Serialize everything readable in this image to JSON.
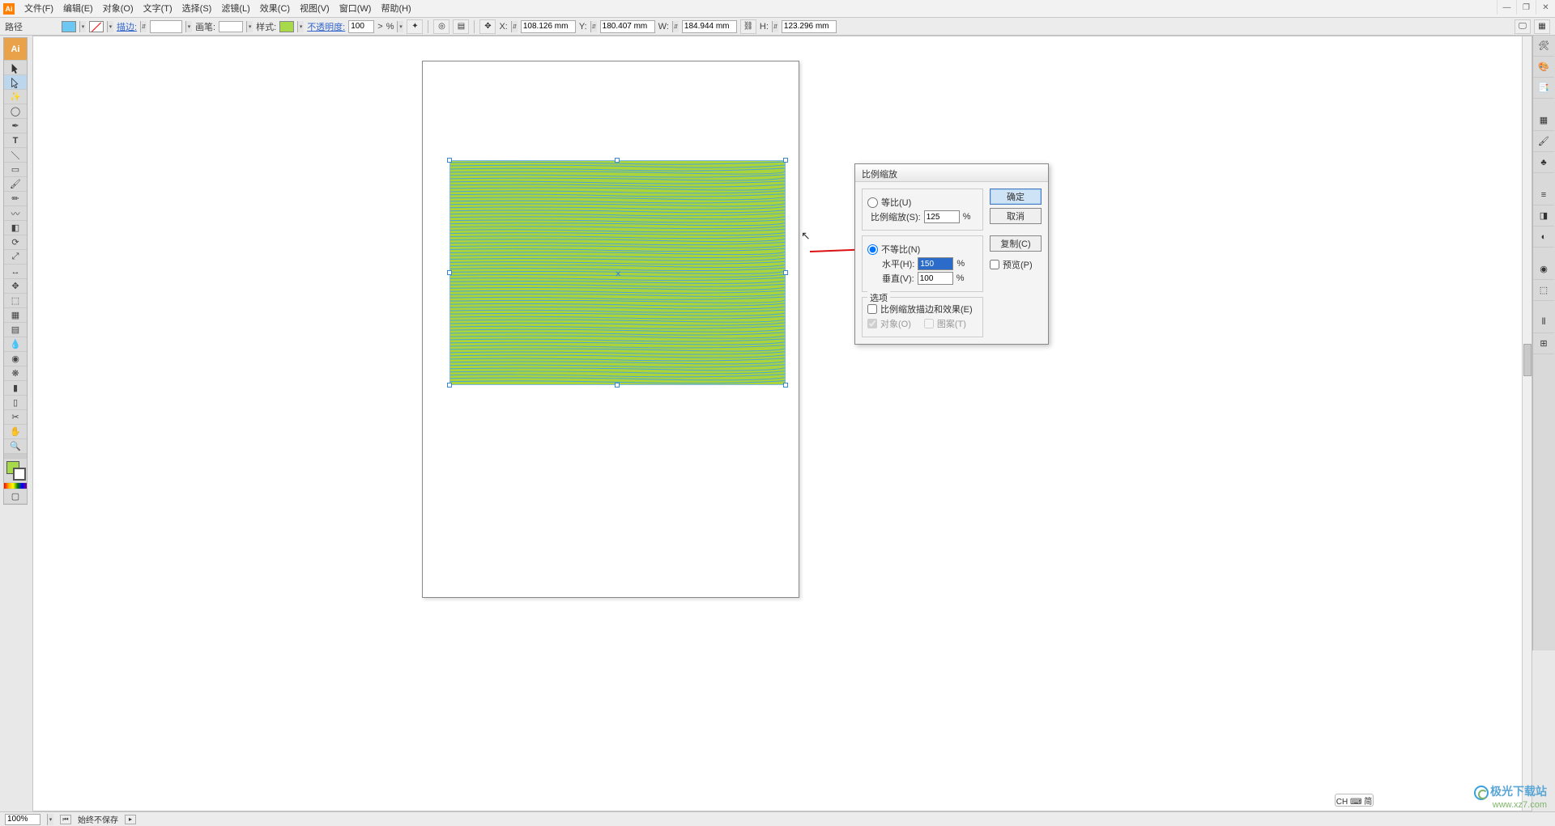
{
  "menu": {
    "file": "文件(F)",
    "edit": "编辑(E)",
    "object": "对象(O)",
    "text": "文字(T)",
    "select": "选择(S)",
    "filter": "滤镜(L)",
    "effect": "效果(C)",
    "view": "视图(V)",
    "window": "窗口(W)",
    "help": "帮助(H)"
  },
  "ctrl": {
    "path": "路径",
    "stroke": "描边:",
    "stroke_val": "",
    "brush": "画笔:",
    "style": "样式:",
    "opacity": "不透明度:",
    "opacity_val": "100",
    "pct": "%",
    "x_lbl": "X:",
    "x_val": "108.126 mm",
    "y_lbl": "Y:",
    "y_val": "180.407 mm",
    "w_lbl": "W:",
    "w_val": "184.944 mm",
    "h_lbl": "H:",
    "h_val": "123.296 mm",
    "arrow": ">"
  },
  "dialog": {
    "title": "比例缩放",
    "uniform": "等比(U)",
    "uniform_scale_lbl": "比例缩放(S):",
    "uniform_scale_val": "125",
    "pct": "%",
    "nonuniform": "不等比(N)",
    "h_lbl": "水平(H):",
    "h_val": "150",
    "v_lbl": "垂直(V):",
    "v_val": "100",
    "options": "选项",
    "scale_strokes": "比例缩放描边和效果(E)",
    "objects": "对象(O)",
    "patterns": "图案(T)",
    "ok": "确定",
    "cancel": "取消",
    "copy": "复制(C)",
    "preview": "预览(P)"
  },
  "status": {
    "zoom": "100%",
    "save": "始终不保存"
  },
  "ime": {
    "text": "CH ⌨ 简"
  },
  "watermark": {
    "name": "极光下载站",
    "url": "www.xz7.com"
  },
  "colors": {
    "fill": "#6cc8f2",
    "style": "#a7d94a"
  }
}
